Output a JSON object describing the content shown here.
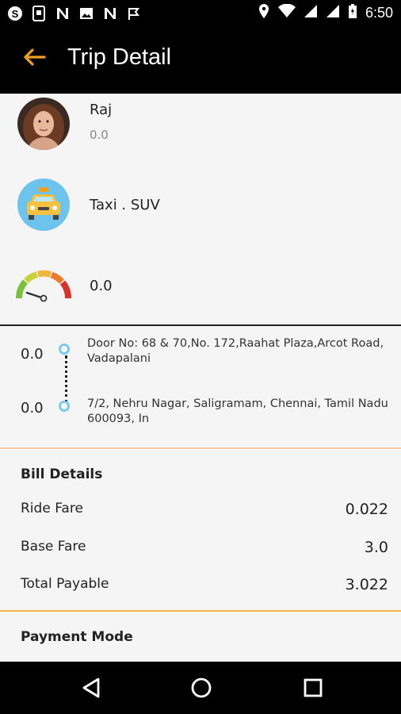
{
  "status_bar": {
    "left_icons": [
      "skype-icon",
      "phone-card-icon",
      "n-icon",
      "image-icon",
      "n-icon",
      "checkmark-flag-icon"
    ],
    "time": "6:50"
  },
  "header": {
    "title": "Trip Detail"
  },
  "driver": {
    "name": "Raj",
    "rating": "0.0"
  },
  "vehicle": {
    "type": "Taxi . SUV"
  },
  "distance": {
    "value": "0.0"
  },
  "route": {
    "pickup": {
      "value": "0.0",
      "address": "Door No: 68 & 70,No. 172,Raahat Plaza,Arcot Road, Vadapalani"
    },
    "drop": {
      "value": "0.0",
      "address": "7/2, Nehru Nagar, Saligramam, Chennai, Tamil Nadu 600093, In"
    }
  },
  "bill": {
    "title": "Bill Details",
    "items": [
      {
        "label": "Ride Fare",
        "value": "0.022"
      },
      {
        "label": "Base Fare",
        "value": "3.0"
      },
      {
        "label": "Total Payable",
        "value": "3.022"
      }
    ]
  },
  "payment": {
    "title": "Payment Mode"
  },
  "colors": {
    "accent": "#f0a020",
    "route_dot": "#79c9f2",
    "bar": "#000000"
  }
}
